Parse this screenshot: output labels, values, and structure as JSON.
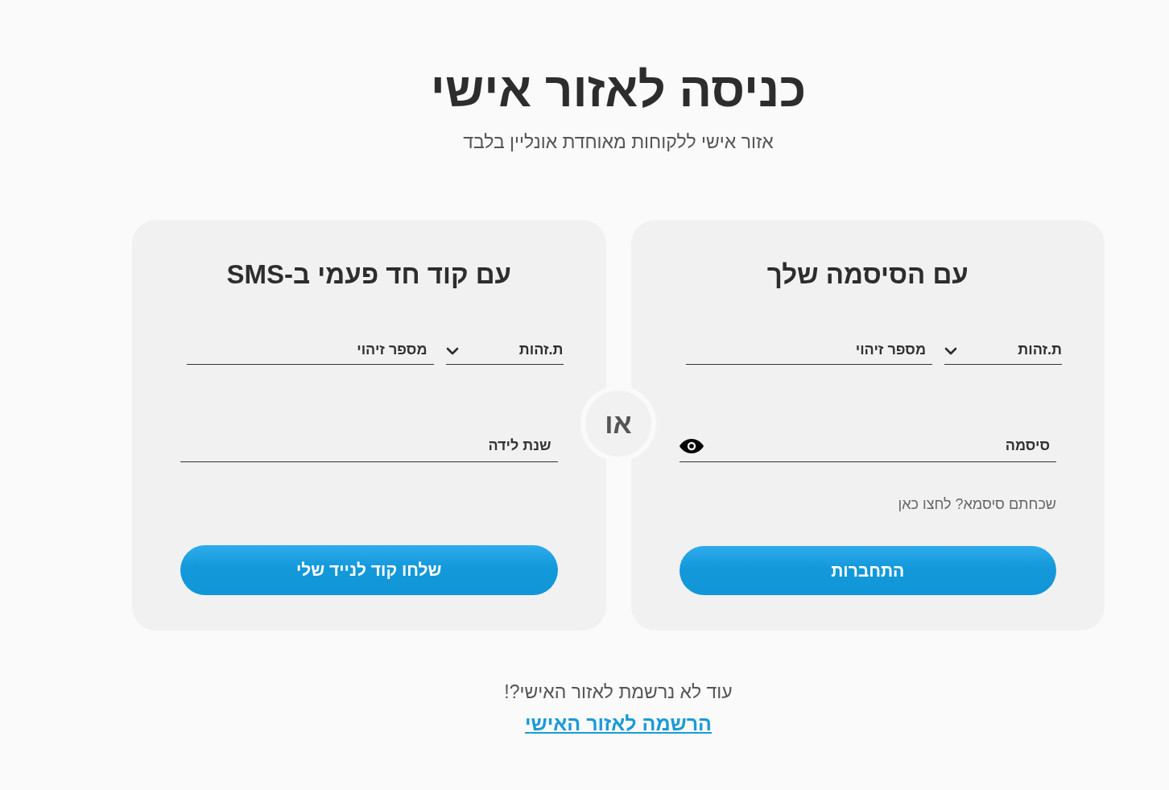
{
  "header": {
    "title": "כניסה לאזור אישי",
    "subtitle": "אזור אישי ללקוחות מאוחדת אונליין בלבד"
  },
  "login_cards": [
    {
      "title": "עם הסיסמה שלך",
      "id_type": {
        "value": "ת.זהות"
      },
      "id_number": {
        "placeholder": "מספר זיהוי"
      },
      "secret_field": {
        "kind": "password",
        "placeholder": "סיסמה"
      },
      "forgot_link": "שכחתם סיסמא? לחצו כאן",
      "submit_button": "התחברות"
    },
    {
      "title": "עם קוד חד פעמי ב-SMS",
      "id_type": {
        "value": "ת.זהות"
      },
      "id_number": {
        "placeholder": "מספר זיהוי"
      },
      "secret_field": {
        "kind": "text",
        "placeholder": "שנת לידה"
      },
      "submit_button": "שלחו קוד לנייד שלי"
    }
  ],
  "divider_label": "או",
  "signup": {
    "prompt": "עוד לא נרשמת לאזור האישי?!",
    "link": "הרשמה לאזור האישי"
  }
}
